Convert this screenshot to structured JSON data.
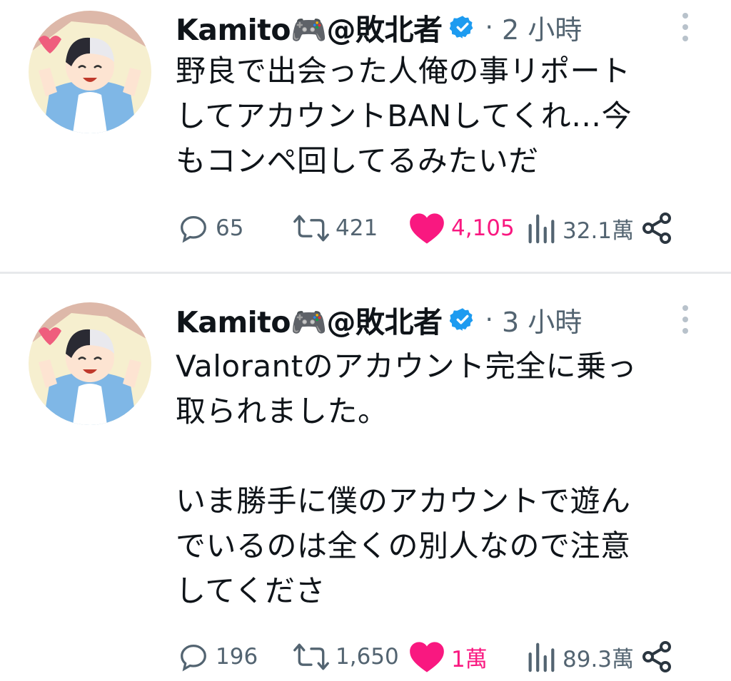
{
  "tweets": [
    {
      "display_name": "Kamito🎮@敗北者",
      "time_separator": "·",
      "time": "2 小時",
      "text": "野良で出会った人俺の事リポート\nしてアカウントBANしてくれ…今\nもコンペ回してるみたいだ",
      "replies": "65",
      "retweets": "421",
      "likes": "4,105",
      "views": "32.1萬",
      "liked": true
    },
    {
      "display_name": "Kamito🎮@敗北者",
      "time_separator": "·",
      "time": "3 小時",
      "text": "Valorantのアカウント完全に乗っ\n取られました。\n\nいま勝手に僕のアカウントで遊ん\nでいるのは全くの別人なので注意\nしてくださ",
      "replies": "196",
      "retweets": "1,650",
      "likes": "1萬",
      "views": "89.3萬",
      "liked": true
    }
  ],
  "colors": {
    "like": "#f91880",
    "verified": "#1d9bf0",
    "muted": "#536471",
    "divider": "#e7e9eb"
  },
  "icons": [
    "avatar",
    "verified-badge-icon",
    "more-icon",
    "reply-icon",
    "retweet-icon",
    "like-icon",
    "views-icon",
    "share-icon"
  ]
}
